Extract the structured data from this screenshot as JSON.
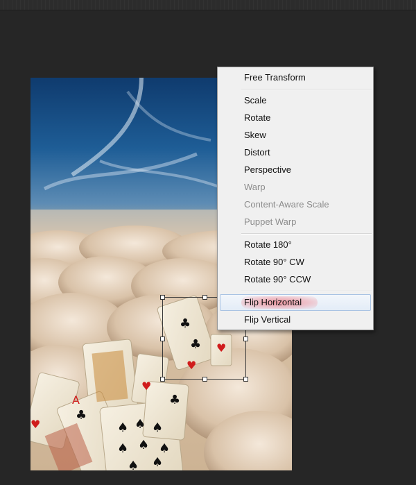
{
  "context_menu": {
    "items": [
      {
        "label": "Free Transform",
        "enabled": true
      },
      {
        "label": "Scale",
        "enabled": true
      },
      {
        "label": "Rotate",
        "enabled": true
      },
      {
        "label": "Skew",
        "enabled": true
      },
      {
        "label": "Distort",
        "enabled": true
      },
      {
        "label": "Perspective",
        "enabled": true
      },
      {
        "label": "Warp",
        "enabled": false
      },
      {
        "label": "Content-Aware Scale",
        "enabled": false
      },
      {
        "label": "Puppet Warp",
        "enabled": false
      },
      {
        "label": "Rotate 180°",
        "enabled": true
      },
      {
        "label": "Rotate 90° CW",
        "enabled": true
      },
      {
        "label": "Rotate 90° CCW",
        "enabled": true
      },
      {
        "label": "Flip Horizontal",
        "enabled": true,
        "hovered": true
      },
      {
        "label": "Flip Vertical",
        "enabled": true
      }
    ]
  },
  "colors": {
    "workspace_bg": "#262626",
    "menu_bg": "#f0f0f0",
    "menu_text": "#111111",
    "menu_text_disabled": "#8c8c8c",
    "hover_border": "#a9c3e3",
    "highlight_mark": "#ec7882"
  },
  "canvas": {
    "image_description_icon": "image-layer-icon"
  }
}
